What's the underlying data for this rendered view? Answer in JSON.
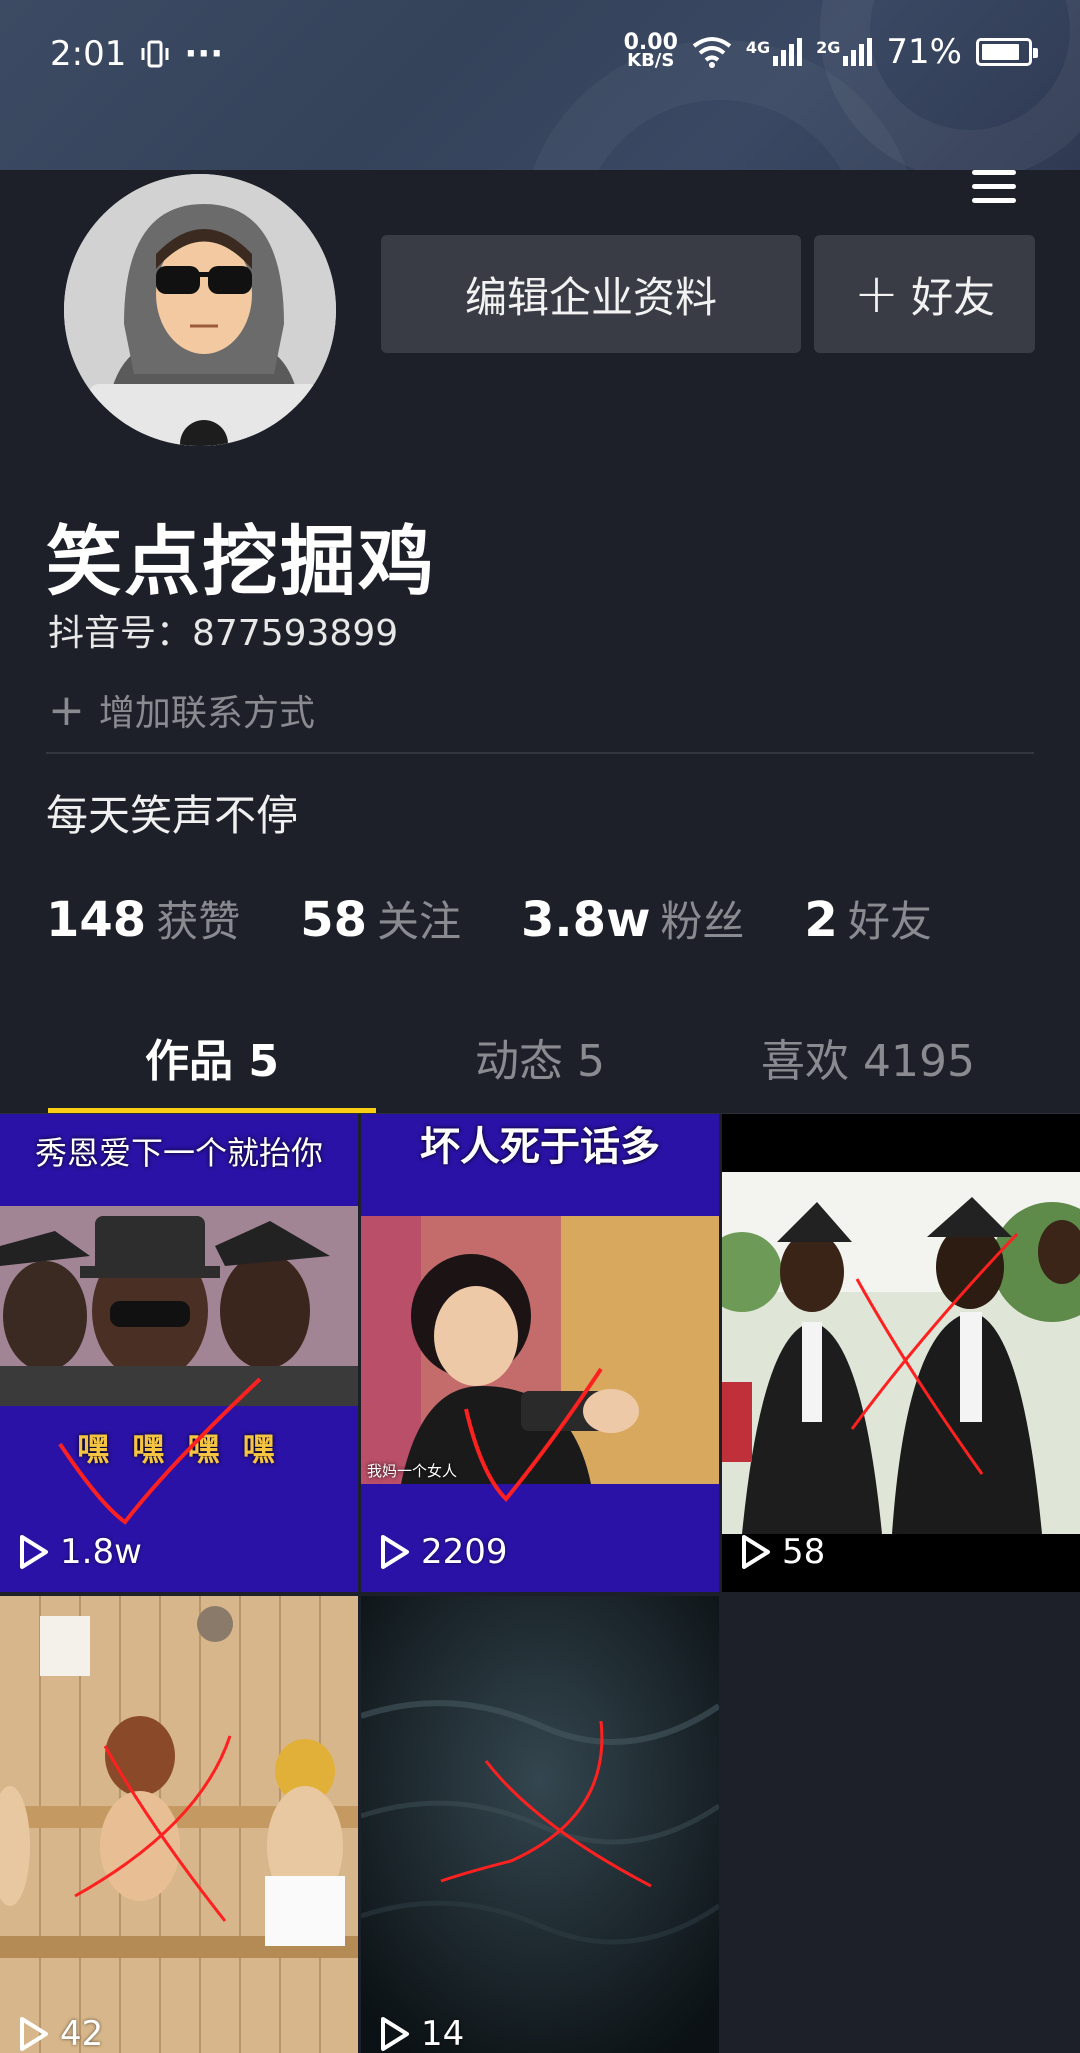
{
  "status_bar": {
    "time": "2:01",
    "dots": "···",
    "net_speed_value": "0.00",
    "net_speed_unit": "KB/S",
    "net1": "4G",
    "net2": "2G",
    "battery": "71%"
  },
  "profile": {
    "name": "笑点挖掘鸡",
    "douyin_id": "抖音号：877593899",
    "add_contact": "增加联系方式",
    "bio": "每天笑声不停"
  },
  "buttons": {
    "edit": "编辑企业资料",
    "add_friend": "好友"
  },
  "stats": [
    {
      "num": "148",
      "label": "获赞"
    },
    {
      "num": "58",
      "label": "关注"
    },
    {
      "num": "3.8w",
      "label": "粉丝"
    },
    {
      "num": "2",
      "label": "好友"
    }
  ],
  "tabs": [
    {
      "label": "作品 5",
      "active": true
    },
    {
      "label": "动态 5",
      "active": false
    },
    {
      "label": "喜欢 4195",
      "active": false
    }
  ],
  "videos": [
    {
      "caption": "秀恩爱下一个就抬你",
      "bottom_text": "嘿 嘿 嘿 嘿",
      "plays": "1.8w"
    },
    {
      "caption": "坏人死于话多",
      "bottom_text": "我妈一个女人",
      "plays": "2209"
    },
    {
      "caption": "",
      "plays": "58"
    },
    {
      "caption": "",
      "plays": "42"
    },
    {
      "caption": "",
      "plays": "14"
    }
  ],
  "colors": {
    "background": "#1e2029",
    "accent": "#face15",
    "button": "#3a3c45"
  }
}
